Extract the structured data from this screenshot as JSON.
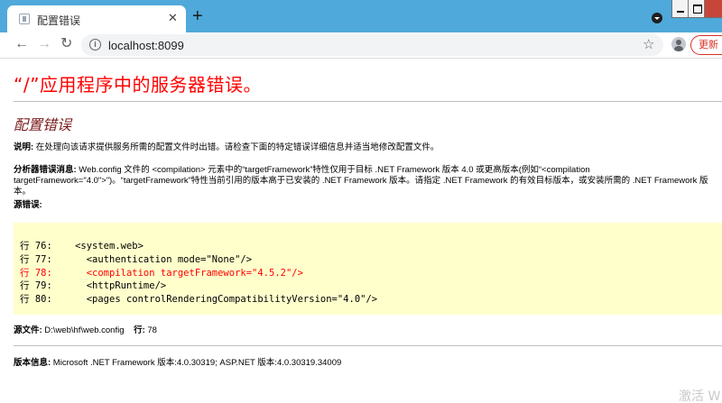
{
  "browser": {
    "tab_title": "配置错误",
    "tab_close": "✕",
    "new_tab": "+",
    "url": "localhost:8099",
    "info_icon": "i",
    "star_icon": "☆",
    "update_label": "更新",
    "nav_back": "←",
    "nav_forward": "→",
    "nav_reload": "↻"
  },
  "error_page": {
    "title": "“/”应用程序中的服务器错误。",
    "subtitle": "配置错误",
    "description_label": "说明:",
    "description_text": " 在处理向该请求提供服务所需的配置文件时出错。请检查下面的特定错误详细信息并适当地修改配置文件。",
    "parser_label": "分析器错误消息:",
    "parser_text": " Web.config 文件的 <compilation> 元素中的“targetFramework”特性仅用于目标 .NET Framework 版本 4.0 或更高版本(例如“<compilation targetFramework=\"4.0\">”)。“targetFramework”特性当前引用的版本高于已安装的 .NET Framework 版本。请指定 .NET Framework 的有效目标版本，或安装所需的 .NET Framework 版本。",
    "source_error_label": "源错误:",
    "code_lines": [
      {
        "text": "行 76:    <system.web>",
        "error": false
      },
      {
        "text": "行 77:      <authentication mode=\"None\"/>",
        "error": false
      },
      {
        "text": "行 78:      <compilation targetFramework=\"4.5.2\"/>",
        "error": true
      },
      {
        "text": "行 79:      <httpRuntime/>",
        "error": false
      },
      {
        "text": "行 80:      <pages controlRenderingCompatibilityVersion=\"4.0\"/>",
        "error": false
      }
    ],
    "source_file_label": "源文件:",
    "source_file_value": " D:\\web\\hf\\web.config",
    "line_label": "行:",
    "line_value": " 78",
    "version_label": "版本信息:",
    "version_text": " Microsoft .NET Framework 版本:4.0.30319; ASP.NET 版本:4.0.30319.34009"
  },
  "watermark": "激活 W",
  "colors": {
    "tab_strip": "#4fa9da",
    "error_title": "#ff0000",
    "subtitle": "#7a1c1c",
    "code_background": "#ffffcc",
    "error_line": "#ff0000"
  }
}
